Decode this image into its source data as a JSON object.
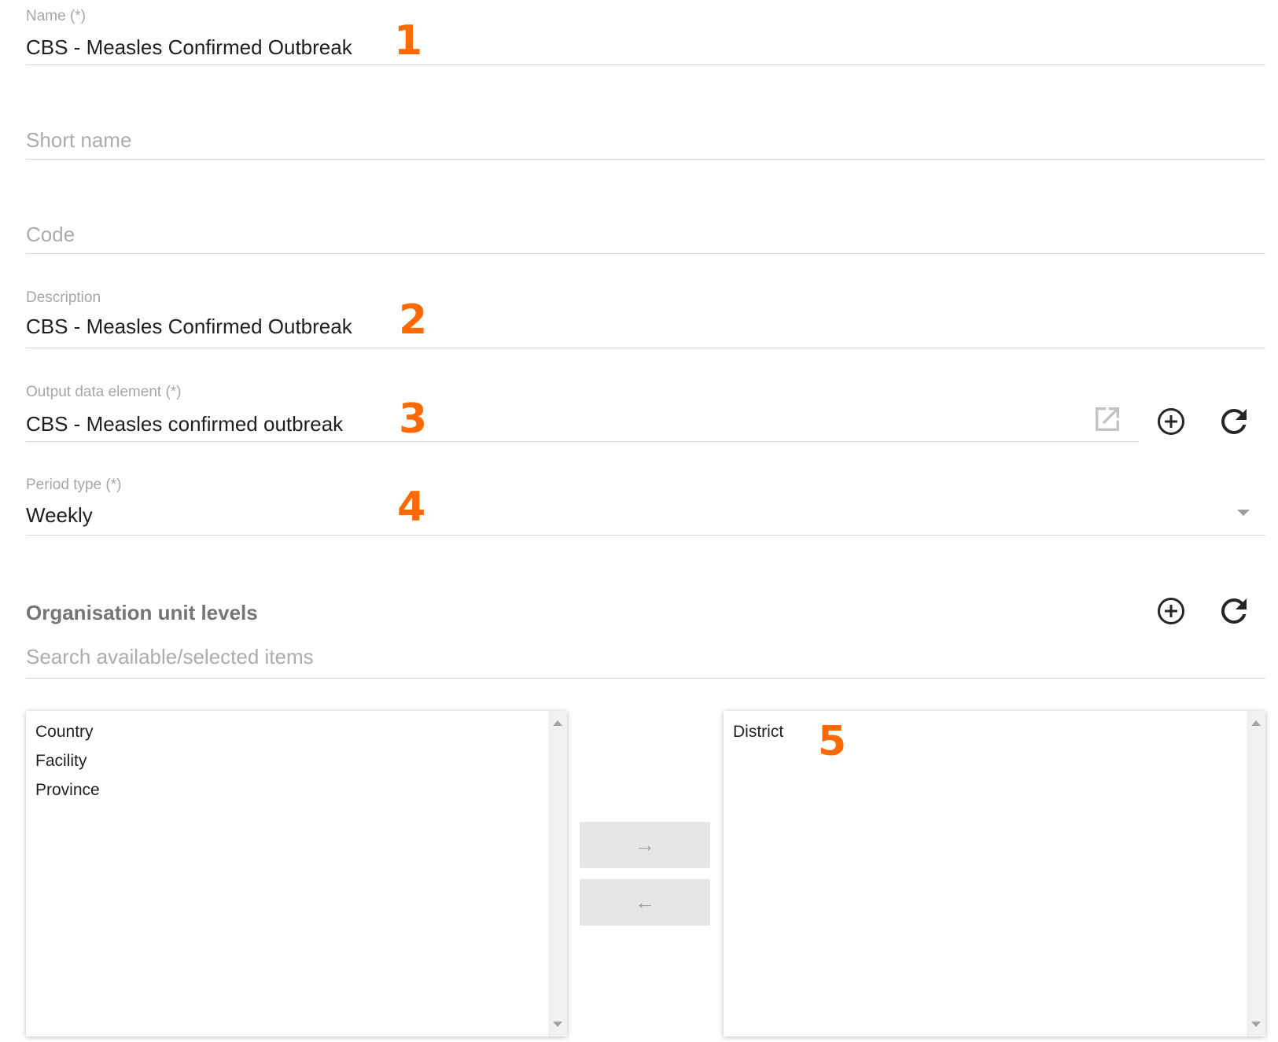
{
  "fields": {
    "name": {
      "label": "Name (*)",
      "value": "CBS - Measles Confirmed Outbreak"
    },
    "short_name": {
      "placeholder": "Short name"
    },
    "code": {
      "placeholder": "Code"
    },
    "description": {
      "label": "Description",
      "value": "CBS - Measles Confirmed Outbreak"
    },
    "output_data_element": {
      "label": "Output data element (*)",
      "value": "CBS - Measles confirmed outbreak"
    },
    "period_type": {
      "label": "Period type (*)",
      "value": "Weekly"
    }
  },
  "markers": [
    "1",
    "2",
    "3",
    "4",
    "5"
  ],
  "org_unit_levels": {
    "title": "Organisation unit levels",
    "search_placeholder": "Search available/selected items",
    "available": [
      "Country",
      "Facility",
      "Province"
    ],
    "selected": [
      "District"
    ],
    "move_right_label": "→",
    "move_left_label": "←"
  },
  "icons": {
    "open_external": "open-in-new-icon",
    "add": "add-circle-icon",
    "refresh": "refresh-icon",
    "dropdown": "caret-down-icon"
  },
  "colors": {
    "marker": "#ff6a00",
    "label": "#a6a6a6",
    "text": "#1f1f1f",
    "underline": "#d8d8d8"
  }
}
